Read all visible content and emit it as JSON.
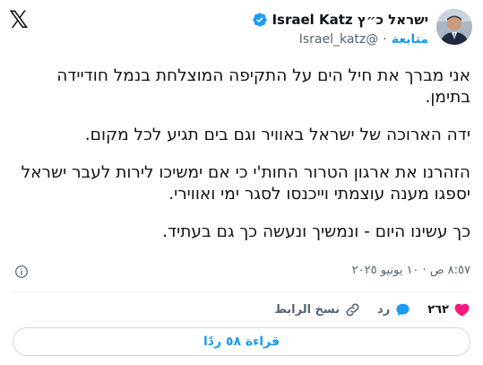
{
  "header": {
    "logo": "𝕏",
    "display_name": "ישראל כ״ץ Israel Katz",
    "handle": "@Israel_katz",
    "separator": "·",
    "follow_label": "متابعة"
  },
  "tweet": {
    "paragraphs": [
      "אני מברך את חיל הים על התקיפה המוצלחת בנמל חודיידה בתימן.",
      "ידה הארוכה של ישראל באוויר וגם בים תגיע לכל מקום.",
      "הזהרנו את ארגון הטרור החות'י כי אם ימשיכו לירות לעבר ישראל יספגו מענה עוצמתי וייכנסו לסגר ימי ואווירי.",
      "כך עשינו היום - ונמשיך ונעשה כך גם בעתיד."
    ],
    "timestamp": "٨:٥٧ ص · ١٠ يونيو ٢٠٢٥"
  },
  "actions": {
    "like_count": "٢٦٢",
    "reply_label": "رد",
    "copy_link_label": "نسخ الرابط"
  },
  "read_replies_label": "قراءة ٥٨ ردًا",
  "colors": {
    "accent": "#1d9bf0",
    "like": "#f91880",
    "text": "#0f1419",
    "muted": "#536471"
  }
}
